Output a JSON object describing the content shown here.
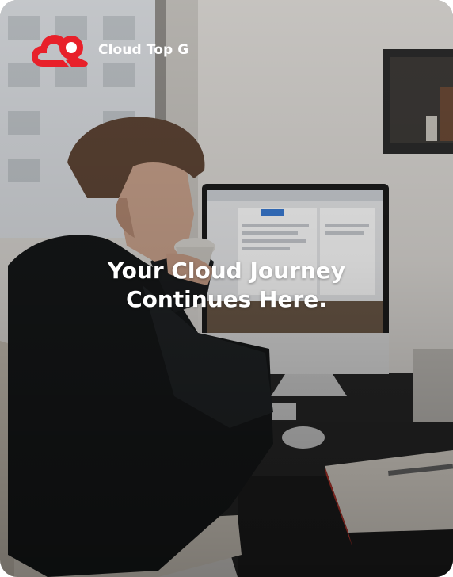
{
  "brand": {
    "name": "Cloud Top G",
    "logo_icon": "cloud-search-icon",
    "logo_color": "#e8202a"
  },
  "hero": {
    "headline_line1": "Your Cloud Journey",
    "headline_line2": "Continues Here."
  }
}
